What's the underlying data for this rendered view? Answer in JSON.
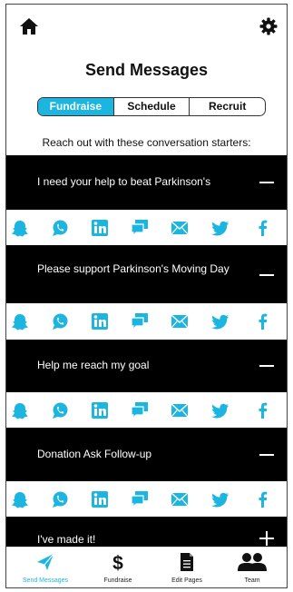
{
  "header": {
    "home_icon": "home-icon",
    "settings_icon": "gear-icon"
  },
  "page": {
    "title": "Send Messages",
    "tabs": [
      {
        "label": "Fundraise",
        "active": true
      },
      {
        "label": "Schedule",
        "active": false
      },
      {
        "label": "Recruit",
        "active": false
      }
    ],
    "subtitle": "Reach out with these conversation starters:"
  },
  "messages": [
    {
      "text": "I need your help to beat Parkinson's",
      "expanded": true
    },
    {
      "text": "Please support Parkinson's Moving Day",
      "expanded": true
    },
    {
      "text": "Help me reach my goal",
      "expanded": true
    },
    {
      "text": "Donation Ask Follow-up",
      "expanded": true
    },
    {
      "text": "I've made it!",
      "expanded": false
    }
  ],
  "share_channels": [
    "snapchat",
    "whatsapp",
    "linkedin",
    "sms",
    "email",
    "twitter",
    "facebook"
  ],
  "nav": [
    {
      "label": "Send Messages",
      "icon": "paper-plane-icon",
      "active": true
    },
    {
      "label": "Fundraise",
      "icon": "dollar-icon",
      "active": false
    },
    {
      "label": "Edit Pages",
      "icon": "document-icon",
      "active": false
    },
    {
      "label": "Team",
      "icon": "team-icon",
      "active": false
    }
  ],
  "colors": {
    "accent": "#1cb5e0",
    "bar": "#000000",
    "text": "#111111"
  }
}
